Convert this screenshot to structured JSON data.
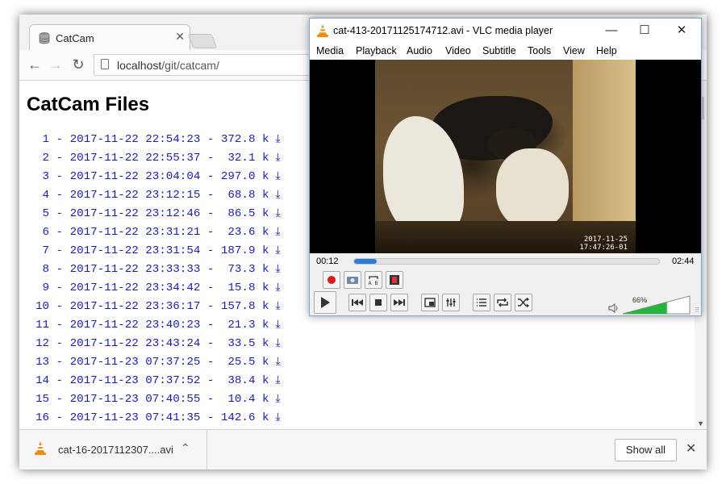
{
  "browser": {
    "tab_title": "CatCam",
    "url_host": "localhost",
    "url_path": "/git/catcam/",
    "page_title": "CatCam Files",
    "files": [
      {
        "n": 1,
        "ts": "2017-11-22 22:54:23",
        "size": "372.8 k"
      },
      {
        "n": 2,
        "ts": "2017-11-22 22:55:37",
        "size": " 32.1 k"
      },
      {
        "n": 3,
        "ts": "2017-11-22 23:04:04",
        "size": "297.0 k"
      },
      {
        "n": 4,
        "ts": "2017-11-22 23:12:15",
        "size": " 68.8 k"
      },
      {
        "n": 5,
        "ts": "2017-11-22 23:12:46",
        "size": " 86.5 k"
      },
      {
        "n": 6,
        "ts": "2017-11-22 23:31:21",
        "size": " 23.6 k"
      },
      {
        "n": 7,
        "ts": "2017-11-22 23:31:54",
        "size": "187.9 k"
      },
      {
        "n": 8,
        "ts": "2017-11-22 23:33:33",
        "size": " 73.3 k"
      },
      {
        "n": 9,
        "ts": "2017-11-22 23:34:42",
        "size": " 15.8 k"
      },
      {
        "n": 10,
        "ts": "2017-11-22 23:36:17",
        "size": "157.8 k"
      },
      {
        "n": 11,
        "ts": "2017-11-22 23:40:23",
        "size": " 21.3 k"
      },
      {
        "n": 12,
        "ts": "2017-11-22 23:43:24",
        "size": " 33.5 k"
      },
      {
        "n": 13,
        "ts": "2017-11-23 07:37:25",
        "size": " 25.5 k"
      },
      {
        "n": 14,
        "ts": "2017-11-23 07:37:52",
        "size": " 38.4 k"
      },
      {
        "n": 15,
        "ts": "2017-11-23 07:40:55",
        "size": " 10.4 k"
      },
      {
        "n": 16,
        "ts": "2017-11-23 07:41:35",
        "size": "142.6 k"
      }
    ],
    "download_icon_glyph": "⤓",
    "download": {
      "file_name": "cat-16-2017112307....avi",
      "show_all": "Show all"
    }
  },
  "vlc": {
    "title": "cat-413-20171125174712.avi - VLC media player",
    "menu": [
      "Media",
      "Playback",
      "Audio",
      "Video",
      "Subtitle",
      "Tools",
      "View",
      "Help"
    ],
    "video_timestamp_date": "2017-11-25",
    "video_timestamp_time": "17:47:26-01",
    "elapsed": "00:12",
    "duration": "02:44",
    "progress_fraction": 0.073,
    "volume_label": "66%",
    "volume_fraction": 0.66,
    "accent_color": "#2f7bd6",
    "volume_color": "#27b43e",
    "record_color": "#e01818"
  }
}
